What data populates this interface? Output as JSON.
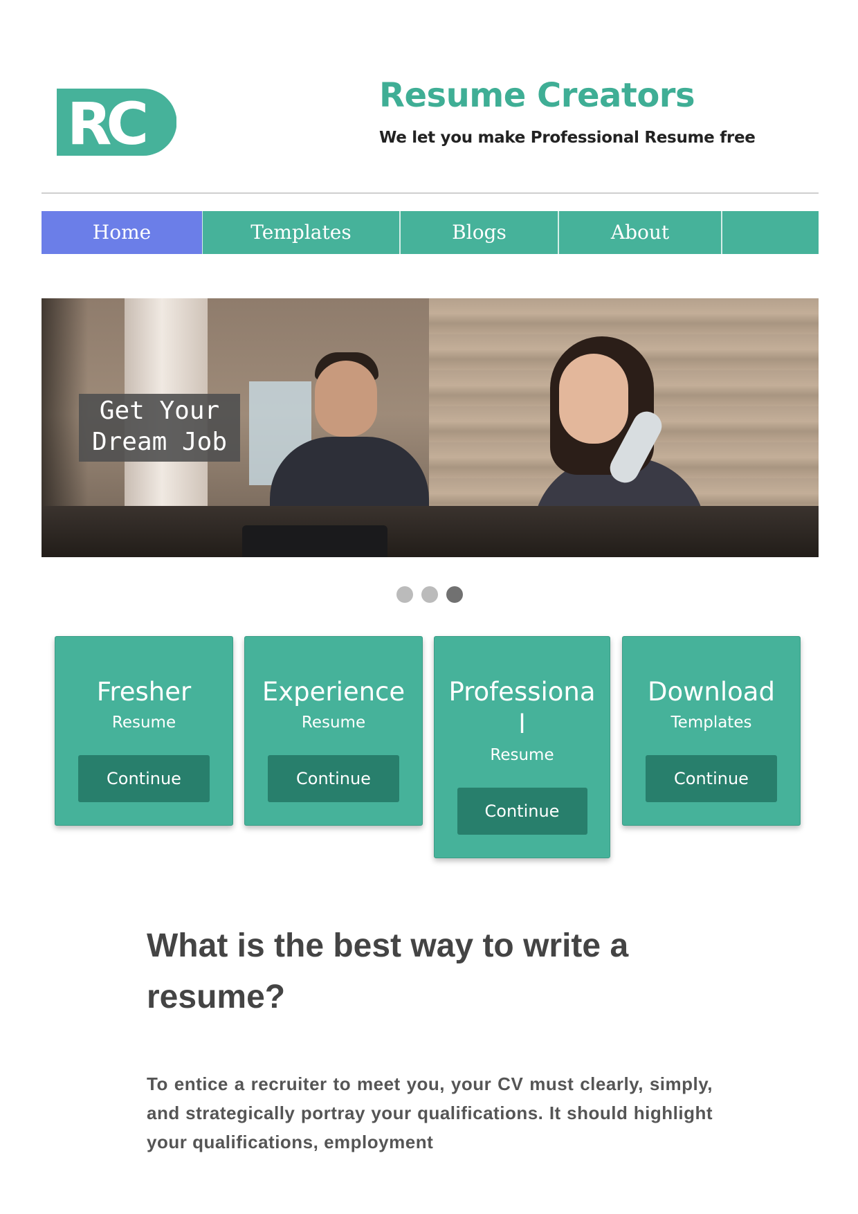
{
  "header": {
    "logo_text": "RC",
    "title": "Resume Creators",
    "tagline": "We let you make Professional Resume free"
  },
  "nav": {
    "items": [
      {
        "label": "Home",
        "active": true
      },
      {
        "label": "Templates"
      },
      {
        "label": "Blogs"
      },
      {
        "label": "About"
      },
      {
        "label": ""
      }
    ]
  },
  "hero": {
    "caption_line1": "Get Your",
    "caption_line2": "Dream Job",
    "slides": 3,
    "active_slide": 3
  },
  "cards": [
    {
      "title": "Fresher",
      "subtitle": "Resume",
      "button": "Continue"
    },
    {
      "title": "Experience",
      "subtitle": "Resume",
      "button": "Continue"
    },
    {
      "title": "Professional",
      "subtitle": "Resume",
      "button": "Continue"
    },
    {
      "title": "Download",
      "subtitle": "Templates",
      "button": "Continue"
    }
  ],
  "article": {
    "title": "What is the best way to write a resume?",
    "body": "To entice a recruiter to meet you, your CV must clearly, simply, and strategically portray your qualifications. It should highlight your qualifications, employment"
  },
  "colors": {
    "brand": "#46b29a",
    "nav_active": "#6b7ee8",
    "button": "#287f6c"
  }
}
